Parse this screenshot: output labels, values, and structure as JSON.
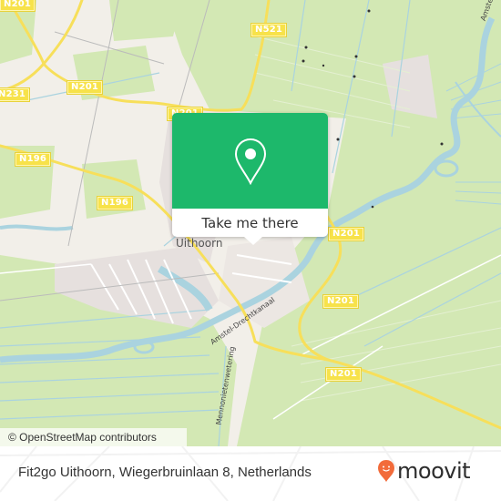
{
  "map": {
    "road_labels": [
      {
        "id": "n201-a",
        "text": "N201"
      },
      {
        "id": "n231",
        "text": "N231"
      },
      {
        "id": "n201-b",
        "text": "N201"
      },
      {
        "id": "n521",
        "text": "N521"
      },
      {
        "id": "n201-c",
        "text": "N201"
      },
      {
        "id": "n196-a",
        "text": "N196"
      },
      {
        "id": "n196-b",
        "text": "N196"
      },
      {
        "id": "n201-d",
        "text": "N201"
      },
      {
        "id": "n201-e",
        "text": "N201"
      },
      {
        "id": "n201-f",
        "text": "N201"
      }
    ],
    "place_label": "Uithoorn",
    "canal_labels": [
      "Amstel-Drechtkanaal",
      "Mennonietenwetering",
      "Amstel"
    ],
    "attribution": "© OpenStreetMap contributors",
    "colors": {
      "land": "#f2efe9",
      "farmland": "#d3e8b4",
      "water": "#aad3df",
      "road": "#f7df5a",
      "residential": "#e6e0de"
    }
  },
  "popup": {
    "button_label": "Take me there",
    "icon": "map-pin-icon",
    "accent_color": "#1db86b"
  },
  "footer": {
    "address": "Fit2go Uithoorn, Wiegerbruinlaan 8, Netherlands",
    "brand": "moovit",
    "brand_color": "#f26b3a"
  }
}
